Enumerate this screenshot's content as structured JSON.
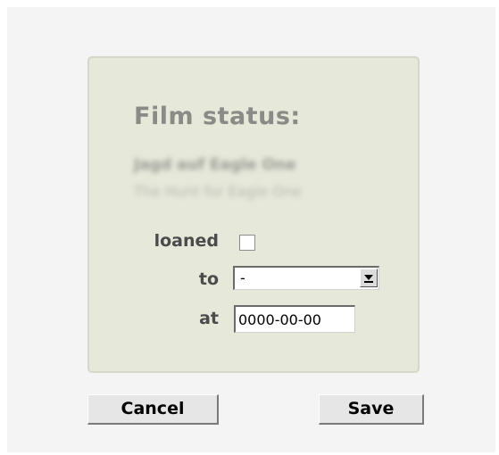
{
  "dialog": {
    "title": "Film status:",
    "film_title": "Jagd auf Eagle One",
    "film_subtitle": "The Hunt for Eagle One"
  },
  "form": {
    "loaned_label": "loaned",
    "loaned_checked": false,
    "to_label": "to",
    "to_value": "-",
    "at_label": "at",
    "at_value": "0000-00-00"
  },
  "buttons": {
    "cancel_label": "Cancel",
    "save_label": "Save"
  },
  "colors": {
    "card_background": "#e6e8da",
    "title_color": "#8a8a86",
    "label_color": "#4b4b4b"
  },
  "icons": {
    "dropdown": "chevron-down-icon"
  }
}
